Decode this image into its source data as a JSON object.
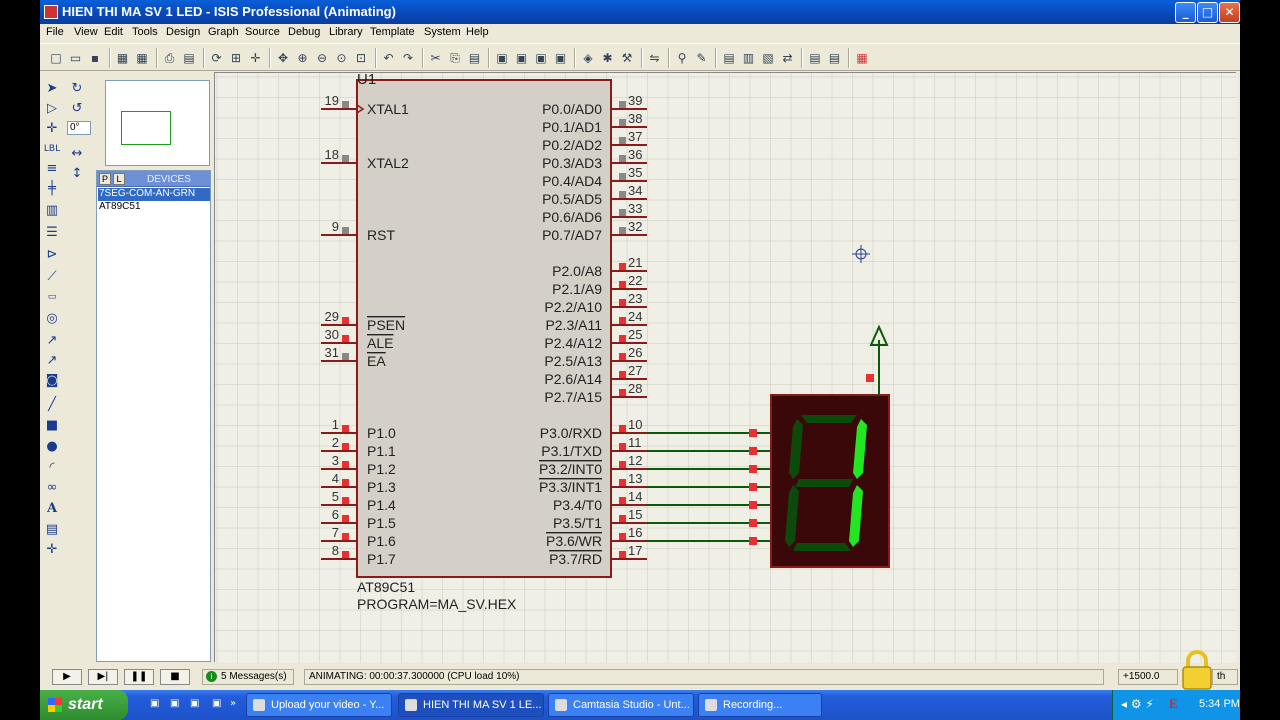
{
  "window": {
    "title": "HIEN THI MA SV 1 LED - ISIS Professional (Animating)",
    "btn_min": "_",
    "btn_max": "□",
    "btn_close": "✕"
  },
  "menu": [
    "File",
    "View",
    "Edit",
    "Tools",
    "Design",
    "Graph",
    "Source",
    "Debug",
    "Library",
    "Template",
    "System",
    "Help"
  ],
  "left_panel": {
    "rotation_value": "0°",
    "tab_p": "P",
    "tab_l": "L",
    "devices_label": "DEVICES",
    "devices": [
      "7SEG-COM-AN-GRN",
      "AT89C51"
    ],
    "selected_device_index": 0
  },
  "schematic": {
    "chip_ref": "U1",
    "chip_part": "AT89C51",
    "chip_program": "PROGRAM=MA_SV.HEX",
    "left_pins": [
      {
        "num": "19",
        "name": "XTAL1"
      },
      {
        "num": "18",
        "name": "XTAL2"
      },
      {
        "num": "9",
        "name": "RST"
      },
      {
        "num": "29",
        "name": "PSEN"
      },
      {
        "num": "30",
        "name": "ALE"
      },
      {
        "num": "31",
        "name": "EA"
      },
      {
        "num": "1",
        "name": "P1.0"
      },
      {
        "num": "2",
        "name": "P1.1"
      },
      {
        "num": "3",
        "name": "P1.2"
      },
      {
        "num": "4",
        "name": "P1.3"
      },
      {
        "num": "5",
        "name": "P1.4"
      },
      {
        "num": "6",
        "name": "P1.5"
      },
      {
        "num": "7",
        "name": "P1.6"
      },
      {
        "num": "8",
        "name": "P1.7"
      }
    ],
    "right_pins": [
      {
        "num": "39",
        "name": "P0.0/AD0"
      },
      {
        "num": "38",
        "name": "P0.1/AD1"
      },
      {
        "num": "37",
        "name": "P0.2/AD2"
      },
      {
        "num": "36",
        "name": "P0.3/AD3"
      },
      {
        "num": "35",
        "name": "P0.4/AD4"
      },
      {
        "num": "34",
        "name": "P0.5/AD5"
      },
      {
        "num": "33",
        "name": "P0.6/AD6"
      },
      {
        "num": "32",
        "name": "P0.7/AD7"
      },
      {
        "num": "21",
        "name": "P2.0/A8"
      },
      {
        "num": "22",
        "name": "P2.1/A9"
      },
      {
        "num": "23",
        "name": "P2.2/A10"
      },
      {
        "num": "24",
        "name": "P2.3/A11"
      },
      {
        "num": "25",
        "name": "P2.4/A12"
      },
      {
        "num": "26",
        "name": "P2.5/A13"
      },
      {
        "num": "27",
        "name": "P2.6/A14"
      },
      {
        "num": "28",
        "name": "P2.7/A15"
      },
      {
        "num": "10",
        "name": "P3.0/RXD"
      },
      {
        "num": "11",
        "name": "P3.1/TXD"
      },
      {
        "num": "12",
        "name": "P3.2/INT0"
      },
      {
        "num": "13",
        "name": "P3.3/INT1"
      },
      {
        "num": "14",
        "name": "P3.4/T0"
      },
      {
        "num": "15",
        "name": "P3.5/T1"
      },
      {
        "num": "16",
        "name": "P3.6/WR"
      },
      {
        "num": "17",
        "name": "P3.7/RD"
      }
    ],
    "colors": {
      "chip_outline": "#8b1a1a",
      "chip_fill": "#d4d0c8",
      "wire": "#0a5a0a",
      "pin_high": "#e83030",
      "pin_low": "#888888",
      "seg_on": "#22e622",
      "seg_off": "#0c4a0c",
      "display_bg": "#3a0808"
    }
  },
  "status": {
    "messages": "5 Messages(s)",
    "animating": "ANIMATING: 00:00:37.300000 (CPU load 10%)",
    "coord_x": "+1500.0",
    "coord_suffix": "th"
  },
  "taskbar": {
    "start": "start",
    "tasks": [
      "Upload your video - Y...",
      "HIEN THI MA SV 1 LE...",
      "Camtasia Studio - Unt...",
      "Recording..."
    ],
    "active_task_index": 1,
    "clock": "5:34 PM"
  }
}
